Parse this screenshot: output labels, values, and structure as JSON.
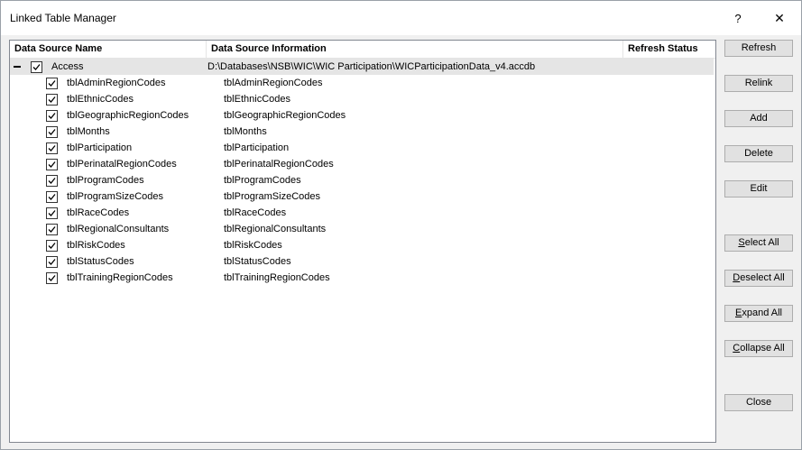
{
  "window": {
    "title": "Linked Table Manager",
    "help_glyph": "?",
    "close_glyph": "✕"
  },
  "columns": {
    "name": "Data Source Name",
    "info": "Data Source Information",
    "status": "Refresh Status"
  },
  "group": {
    "toggle": "−",
    "name": "Access",
    "path": "D:\\Databases\\NSB\\WIC\\WIC Participation\\WICParticipationData_v4.accdb",
    "checked": true
  },
  "rows": [
    {
      "name": "tblAdminRegionCodes",
      "info": "tblAdminRegionCodes",
      "status": ""
    },
    {
      "name": "tblEthnicCodes",
      "info": "tblEthnicCodes",
      "status": ""
    },
    {
      "name": "tblGeographicRegionCodes",
      "info": "tblGeographicRegionCodes",
      "status": ""
    },
    {
      "name": "tblMonths",
      "info": "tblMonths",
      "status": ""
    },
    {
      "name": "tblParticipation",
      "info": "tblParticipation",
      "status": ""
    },
    {
      "name": "tblPerinatalRegionCodes",
      "info": "tblPerinatalRegionCodes",
      "status": ""
    },
    {
      "name": "tblProgramCodes",
      "info": "tblProgramCodes",
      "status": ""
    },
    {
      "name": "tblProgramSizeCodes",
      "info": "tblProgramSizeCodes",
      "status": ""
    },
    {
      "name": "tblRaceCodes",
      "info": "tblRaceCodes",
      "status": ""
    },
    {
      "name": "tblRegionalConsultants",
      "info": "tblRegionalConsultants",
      "status": ""
    },
    {
      "name": "tblRiskCodes",
      "info": "tblRiskCodes",
      "status": ""
    },
    {
      "name": "tblStatusCodes",
      "info": "tblStatusCodes",
      "status": ""
    },
    {
      "name": "tblTrainingRegionCodes",
      "info": "tblTrainingRegionCodes",
      "status": ""
    }
  ],
  "buttons": {
    "refresh": "Refresh",
    "relink": "Relink",
    "add": "Add",
    "delete": "Delete",
    "edit": "Edit",
    "select_all": {
      "mnemonic": "S",
      "rest": "elect All"
    },
    "deselect_all": {
      "mnemonic": "D",
      "rest": "eselect All"
    },
    "expand_all": {
      "mnemonic": "E",
      "rest": "xpand All"
    },
    "collapse_all": {
      "mnemonic": "C",
      "rest": "ollapse All"
    },
    "close": "Close"
  }
}
